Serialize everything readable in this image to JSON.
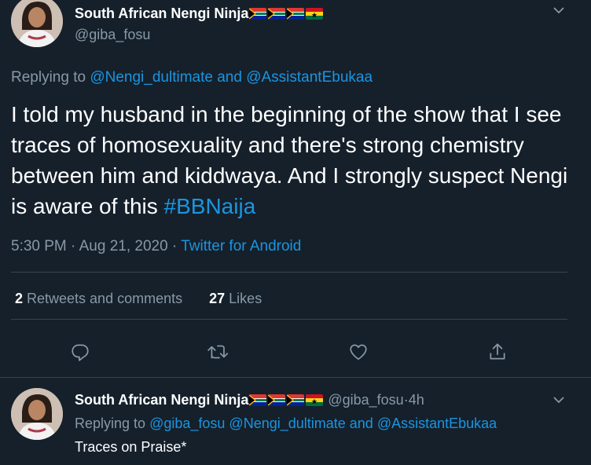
{
  "main_tweet": {
    "display_name": "South African Nengi Ninja",
    "flags": [
      "south-africa",
      "south-africa",
      "south-africa",
      "ghana"
    ],
    "handle": "@giba_fosu",
    "replying_prefix": "Replying to ",
    "replying_user1": "@Nengi_dultimate",
    "replying_and": " and ",
    "replying_user2": "@AssistantEbukaa",
    "text": "I told my husband in the beginning of the show that I see traces of homosexuality and there's strong chemistry between him and kiddwaya. And I strongly suspect Nengi is aware of this ",
    "hashtag": "#BBNaija",
    "time": "5:30 PM",
    "date_sep": " · ",
    "date": "Aug 21, 2020",
    "source_sep": " · ",
    "source": "Twitter for Android",
    "retweets_count": "2",
    "retweets_label": " Retweets and comments",
    "likes_count": "27",
    "likes_label": " Likes"
  },
  "actions": {
    "reply_icon": "comment-icon",
    "retweet_icon": "retweet-icon",
    "like_icon": "heart-icon",
    "share_icon": "share-icon"
  },
  "reply_tweet": {
    "display_name": "South African Nengi Ninja",
    "flags": [
      "south-africa",
      "south-africa",
      "south-africa",
      "ghana"
    ],
    "handle": "@giba_fosu",
    "time_sep": " · ",
    "time": "4h",
    "replying_prefix": "Replying to ",
    "replying_user1": "@giba_fosu",
    "replying_user2": "@Nengi_dultimate",
    "replying_and": " and ",
    "replying_user3": "@AssistantEbukaa",
    "text": "Traces on Praise*"
  },
  "colors": {
    "background": "#15202b",
    "link": "#1b95e0",
    "muted": "#8899a6",
    "divider": "#38444d"
  }
}
